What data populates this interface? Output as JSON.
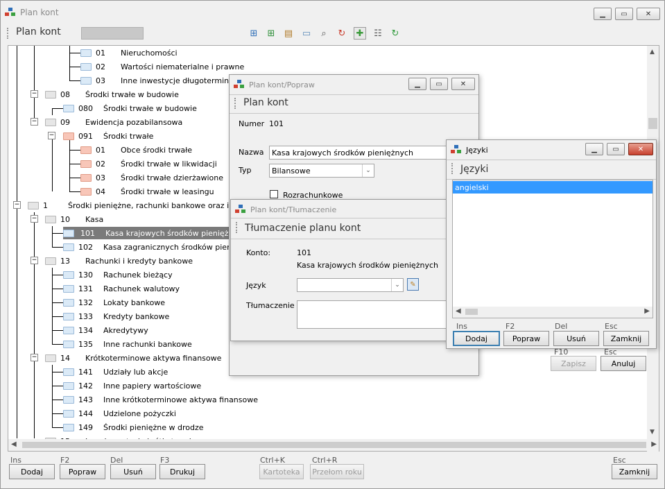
{
  "main": {
    "title": "Plan kont",
    "heading": "Plan kont",
    "toolbar_icons": [
      "add-sibling-icon",
      "add-child-icon",
      "clipboard-icon",
      "comment-icon",
      "search-zoom-icon",
      "refresh-red-icon",
      "new-document-icon",
      "grid-icon",
      "refresh-green-icon"
    ],
    "tree": [
      {
        "code": "01",
        "name": "Nieruchomości",
        "icon": "b"
      },
      {
        "code": "02",
        "name": "Wartości niematerialne i prawne",
        "icon": "b"
      },
      {
        "code": "03",
        "name": "Inne inwestycje długoterminowe",
        "icon": "b"
      },
      {
        "code": "08",
        "name": "Środki trwałe w budowie",
        "icon": "g"
      },
      {
        "code": "080",
        "name": "Środki trwałe w budowie",
        "icon": "b"
      },
      {
        "code": "09",
        "name": "Ewidencja pozabilansowa",
        "icon": "g"
      },
      {
        "code": "091",
        "name": "Środki trwałe",
        "icon": "r"
      },
      {
        "code": "01",
        "name": "Obce środki trwałe",
        "icon": "r"
      },
      {
        "code": "02",
        "name": "Środki trwałe w likwidacji",
        "icon": "r"
      },
      {
        "code": "03",
        "name": "Środki trwałe dzierżawione",
        "icon": "r"
      },
      {
        "code": "04",
        "name": "Środki trwałe w leasingu",
        "icon": "r"
      },
      {
        "code": "1",
        "name": "Środki pieniężne, rachunki bankowe oraz inne krótk",
        "icon": "g"
      },
      {
        "code": "10",
        "name": "Kasa",
        "icon": "g"
      },
      {
        "code": "101",
        "name": "Kasa krajowych środków pieniężnych",
        "icon": "b"
      },
      {
        "code": "102",
        "name": "Kasa zagranicznych środków pienięż",
        "icon": "b"
      },
      {
        "code": "13",
        "name": "Rachunki i kredyty bankowe",
        "icon": "g"
      },
      {
        "code": "130",
        "name": "Rachunek bieżący",
        "icon": "b"
      },
      {
        "code": "131",
        "name": "Rachunek walutowy",
        "icon": "b"
      },
      {
        "code": "132",
        "name": "Lokaty bankowe",
        "icon": "b"
      },
      {
        "code": "133",
        "name": "Kredyty bankowe",
        "icon": "b"
      },
      {
        "code": "134",
        "name": "Akredytywy",
        "icon": "b"
      },
      {
        "code": "135",
        "name": "Inne rachunki bankowe",
        "icon": "b"
      },
      {
        "code": "14",
        "name": "Krótkoterminowe aktywa finansowe",
        "icon": "g"
      },
      {
        "code": "141",
        "name": "Udziały lub akcje",
        "icon": "b"
      },
      {
        "code": "142",
        "name": "Inne papiery wartościowe",
        "icon": "b"
      },
      {
        "code": "143",
        "name": "Inne krótkoterminowe aktywa finansowe",
        "icon": "b"
      },
      {
        "code": "144",
        "name": "Udzielone pożyczki",
        "icon": "b"
      },
      {
        "code": "149",
        "name": "Środki pieniężne w drodze",
        "icon": "b"
      },
      {
        "code": "15",
        "name": "Inne inwestycje krótkoterminowe",
        "icon": "g"
      }
    ],
    "footer": {
      "hotkeys": [
        "Ins",
        "F2",
        "Del",
        "F3",
        "Ctrl+K",
        "Ctrl+R",
        "Esc"
      ],
      "buttons": [
        "Dodaj",
        "Popraw",
        "Usuń",
        "Drukuj",
        "Kartoteka",
        "Przełom roku",
        "Zamknij"
      ]
    }
  },
  "popraw": {
    "title": "Plan kont/Popraw",
    "heading": "Plan kont",
    "numer_label": "Numer",
    "numer_value": "101",
    "nazwa_label": "Nazwa",
    "nazwa_value": "Kasa krajowych środków pieniężnych",
    "typ_label": "Typ",
    "typ_value": "Bilansowe",
    "rozrachunkowe_label": "Rozrachunkowe",
    "hotkey_f10": "F10",
    "hotkey_esc": "Esc",
    "save_label": "Zapisz",
    "cancel_label": "Anuluj"
  },
  "tlumaczenie": {
    "title": "Plan kont/Tłumaczenie",
    "heading": "Tłumaczenie planu kont",
    "konto_label": "Konto:",
    "konto_number": "101",
    "konto_name": "Kasa krajowych środków pieniężnych",
    "jezyk_label": "Język",
    "jezyk_value": "",
    "tlumaczenie_label": "Tłumaczenie",
    "tlumaczenie_value": ""
  },
  "jezyki": {
    "title": "Języki",
    "heading": "Języki",
    "items": [
      "angielski"
    ],
    "hotkeys": [
      "Ins",
      "F2",
      "Del",
      "Esc"
    ],
    "buttons": [
      "Dodaj",
      "Popraw",
      "Usuń",
      "Zamknij"
    ]
  }
}
